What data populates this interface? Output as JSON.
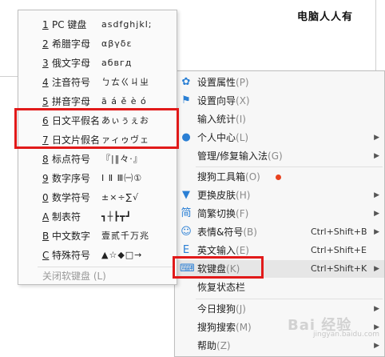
{
  "document": {
    "text": "电脑人人有"
  },
  "soft_keyboard_menu": {
    "items": [
      {
        "num": "1",
        "name": "PC 键盘",
        "sample": "asdfghjkl;"
      },
      {
        "num": "2",
        "name": "希腊字母",
        "sample": "αβγδε"
      },
      {
        "num": "3",
        "name": "俄文字母",
        "sample": "абвгд"
      },
      {
        "num": "4",
        "name": "注音符号",
        "sample": "ㄅㄊㄍㄐㄓ"
      },
      {
        "num": "5",
        "name": "拼音字母",
        "sample": "ā á ě è ó"
      },
      {
        "num": "6",
        "name": "日文平假名",
        "sample": "あぃぅぇお"
      },
      {
        "num": "7",
        "name": "日文片假名",
        "sample": "ァィゥヴェ"
      },
      {
        "num": "8",
        "name": "标点符号",
        "sample": "『|‖々·』"
      },
      {
        "num": "9",
        "name": "数字序号",
        "sample": "Ⅰ Ⅱ Ⅲ㈠①"
      },
      {
        "num": "0",
        "name": "数学符号",
        "sample": "±×÷∑√"
      },
      {
        "num": "A",
        "name": "制表符",
        "sample": "┓┼┣┳┛"
      },
      {
        "num": "B",
        "name": "中文数字",
        "sample": "壹贰千万兆"
      },
      {
        "num": "C",
        "name": "特殊符号",
        "sample": "▲☆◆□→"
      }
    ],
    "close_label": "关闭软键盘 (L)"
  },
  "main_menu": {
    "items": [
      {
        "icon": "gear-icon",
        "glyph": "✿",
        "label": "设置属性",
        "key": "(P)"
      },
      {
        "icon": "flag-icon",
        "glyph": "⚑",
        "label": "设置向导",
        "key": "(X)"
      },
      {
        "icon": "",
        "glyph": "",
        "label": "输入统计",
        "key": "(I)"
      },
      {
        "icon": "person-icon",
        "glyph": "●",
        "label": "个人中心",
        "key": "(L)",
        "arrow": "▶"
      },
      {
        "icon": "",
        "glyph": "",
        "label": "管理/修复输入法",
        "key": "(G)",
        "arrow": "▶"
      },
      {
        "icon": "",
        "glyph": "",
        "label": "搜狗工具箱",
        "key": "(O)",
        "dot": true
      },
      {
        "icon": "shirt-icon",
        "glyph": "▼",
        "label": "更换皮肤",
        "key": "(H)",
        "arrow": "▶"
      },
      {
        "icon": "simplified-traditional-icon",
        "glyph": "简",
        "label": "简繁切换",
        "key": "(F)",
        "arrow": "▶"
      },
      {
        "icon": "emoji-icon",
        "glyph": "☺",
        "label": "表情&符号",
        "key": "(B)",
        "shortcut": "Ctrl+Shift+B",
        "arrow": "▶"
      },
      {
        "icon": "english-icon",
        "glyph": "E",
        "label": "英文输入",
        "key": "(E)",
        "shortcut": "Ctrl+Shift+E"
      },
      {
        "icon": "keyboard-icon",
        "glyph": "⌨",
        "label": "软键盘",
        "key": "(K)",
        "shortcut": "Ctrl+Shift+K",
        "arrow": "▶"
      },
      {
        "icon": "",
        "glyph": "",
        "label": "恢复状态栏",
        "key": ""
      },
      {
        "icon": "",
        "glyph": "",
        "label": "今日搜狗",
        "key": "(J)",
        "arrow": "▶"
      },
      {
        "icon": "",
        "glyph": "",
        "label": "搜狗搜索",
        "key": "(M)",
        "arrow": "▶"
      },
      {
        "icon": "",
        "glyph": "",
        "label": "帮助",
        "key": "(Z)",
        "arrow": "▶"
      }
    ]
  },
  "watermark": {
    "text": "Bai 经验",
    "sub": "jingyan.baidu.com"
  }
}
